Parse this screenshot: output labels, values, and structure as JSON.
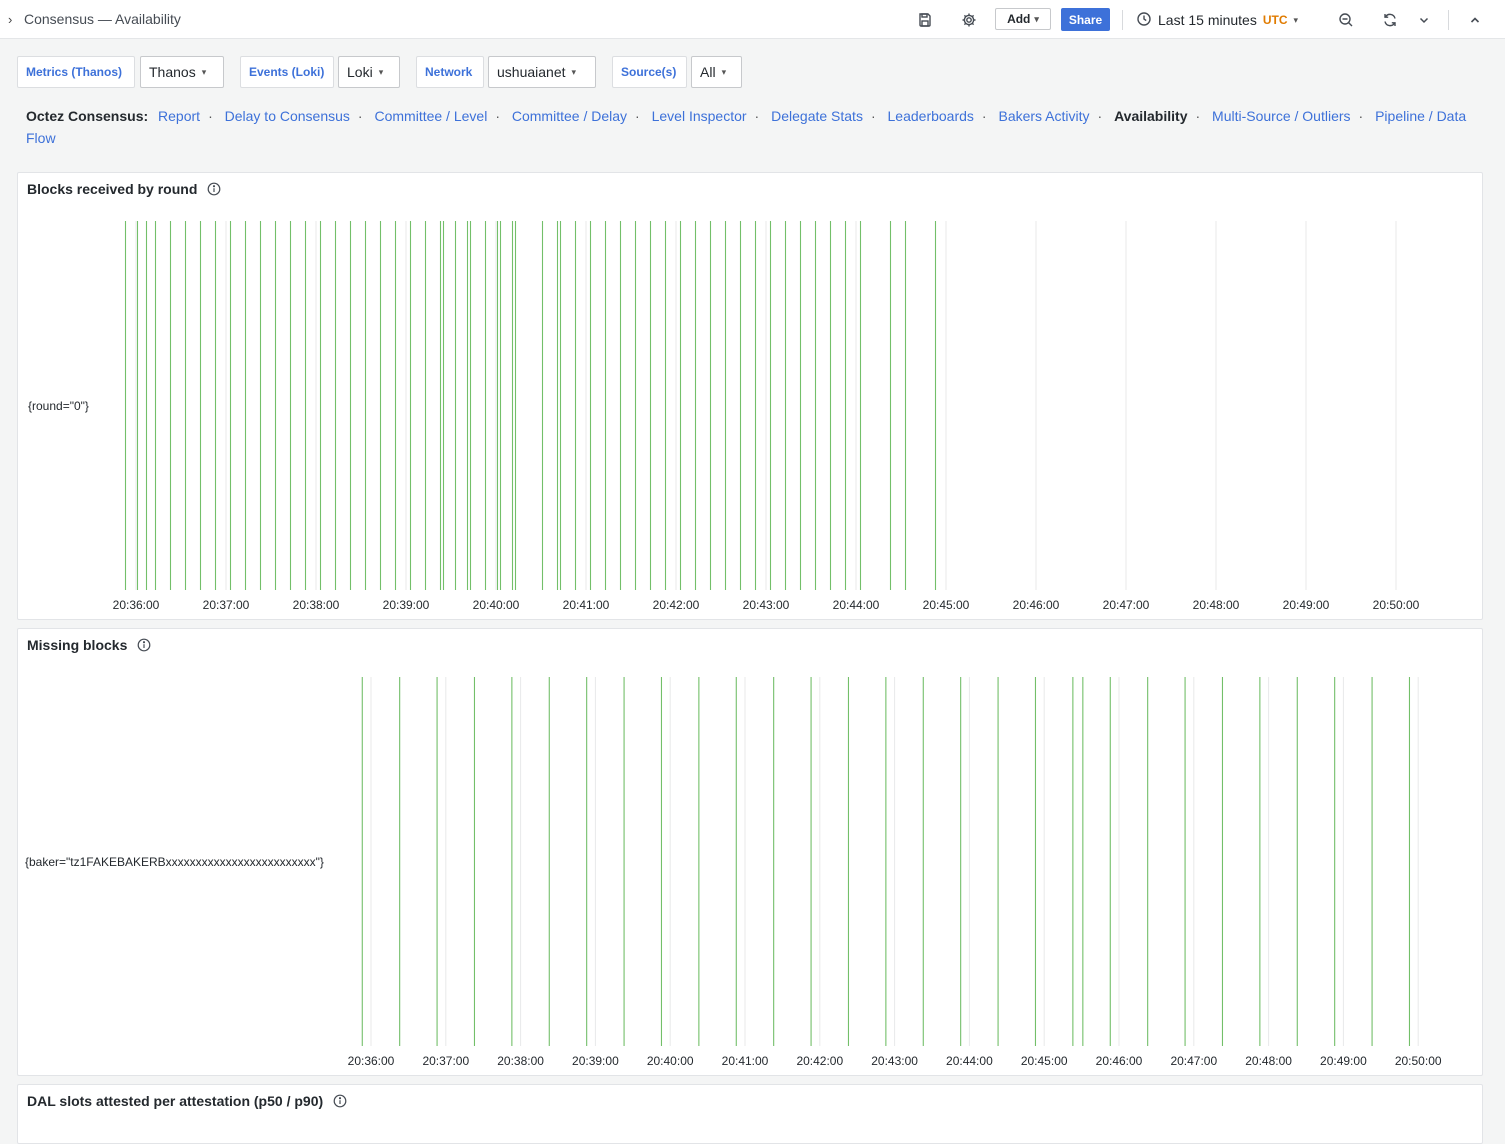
{
  "topbar": {
    "breadcrumb": "Consensus — Availability",
    "add_label": "Add",
    "share_label": "Share",
    "time_range": "Last 15 minutes",
    "timezone": "UTC",
    "icons": [
      "save-icon",
      "gear-icon",
      "clock-icon",
      "zoom-out-icon",
      "refresh-icon",
      "chevron-down-icon",
      "chevron-up-icon"
    ]
  },
  "variables": [
    {
      "label": "Metrics (Thanos)",
      "value": "Thanos"
    },
    {
      "label": "Events (Loki)",
      "value": "Loki"
    },
    {
      "label": "Network",
      "value": "ushuaianet"
    },
    {
      "label": "Source(s)",
      "value": "All"
    }
  ],
  "nav": {
    "lead": "Octez Consensus:",
    "links": [
      "Report",
      "Delay to Consensus",
      "Committee / Level",
      "Committee / Delay",
      "Level Inspector",
      "Delegate Stats",
      "Leaderboards",
      "Bakers Activity",
      "Availability",
      "Multi-Source / Outliers",
      "Pipeline / Data Flow"
    ],
    "current": "Availability"
  },
  "colors": {
    "accent": "#3d71d9",
    "series": "#73bf69",
    "grid": "#e8e9ea",
    "timezone": "#e07b00"
  },
  "panels": {
    "blocks": {
      "title": "Blocks received by round",
      "series_label": "{round=\"0\"}"
    },
    "missing": {
      "title": "Missing blocks",
      "series_label": "{baker=\"tz1FAKEBAKERBxxxxxxxxxxxxxxxxxxxxxxxxx\"}"
    },
    "dal": {
      "title": "DAL slots attested per attestation (p50 / p90)"
    }
  },
  "chart_data": [
    {
      "type": "state-timeline",
      "title": "Blocks received by round",
      "series": [
        {
          "name": "{round=\"0\"}"
        }
      ],
      "x_ticks": [
        "20:36:00",
        "20:37:00",
        "20:38:00",
        "20:39:00",
        "20:40:00",
        "20:41:00",
        "20:42:00",
        "20:43:00",
        "20:44:00",
        "20:45:00",
        "20:46:00",
        "20:47:00",
        "20:48:00",
        "20:49:00",
        "20:50:00"
      ],
      "xlim": [
        "20:35:53",
        "20:50:53"
      ],
      "event_times": [
        "20:35:53",
        "20:36:01",
        "20:36:07",
        "20:36:13",
        "20:36:23",
        "20:36:33",
        "20:36:43",
        "20:36:53",
        "20:37:03",
        "20:37:13",
        "20:37:23",
        "20:37:33",
        "20:37:43",
        "20:37:53",
        "20:38:03",
        "20:38:13",
        "20:38:23",
        "20:38:33",
        "20:38:43",
        "20:38:53",
        "20:39:03",
        "20:39:13",
        "20:39:23",
        "20:39:25",
        "20:39:33",
        "20:39:41",
        "20:39:43",
        "20:39:53",
        "20:40:01",
        "20:40:03",
        "20:40:11",
        "20:40:13",
        "20:40:31",
        "20:40:41",
        "20:40:43",
        "20:40:53",
        "20:41:03",
        "20:41:13",
        "20:41:23",
        "20:41:33",
        "20:41:43",
        "20:41:53",
        "20:42:03",
        "20:42:13",
        "20:42:23",
        "20:42:33",
        "20:42:43",
        "20:42:53",
        "20:43:03",
        "20:43:13",
        "20:43:23",
        "20:43:33",
        "20:43:43",
        "20:43:53",
        "20:44:03",
        "20:44:23",
        "20:44:33",
        "20:44:53"
      ]
    },
    {
      "type": "state-timeline",
      "title": "Missing blocks",
      "series": [
        {
          "name": "{baker=\"tz1FAKEBAKERBxxxxxxxxxxxxxxxxxxxxxxxxx\"}"
        }
      ],
      "x_ticks": [
        "20:36:00",
        "20:37:00",
        "20:38:00",
        "20:39:00",
        "20:40:00",
        "20:41:00",
        "20:42:00",
        "20:43:00",
        "20:44:00",
        "20:45:00",
        "20:46:00",
        "20:47:00",
        "20:48:00",
        "20:49:00",
        "20:50:00"
      ],
      "xlim": [
        "20:35:53",
        "20:50:53"
      ],
      "event_times": [
        "20:35:53",
        "20:36:23",
        "20:36:53",
        "20:37:23",
        "20:37:53",
        "20:38:23",
        "20:38:53",
        "20:39:23",
        "20:39:53",
        "20:40:23",
        "20:40:53",
        "20:41:23",
        "20:41:53",
        "20:42:23",
        "20:42:53",
        "20:43:23",
        "20:43:53",
        "20:44:23",
        "20:44:53",
        "20:45:23",
        "20:45:31",
        "20:45:53",
        "20:46:23",
        "20:46:53",
        "20:47:23",
        "20:47:53",
        "20:48:23",
        "20:48:53",
        "20:49:23",
        "20:49:53"
      ]
    }
  ]
}
